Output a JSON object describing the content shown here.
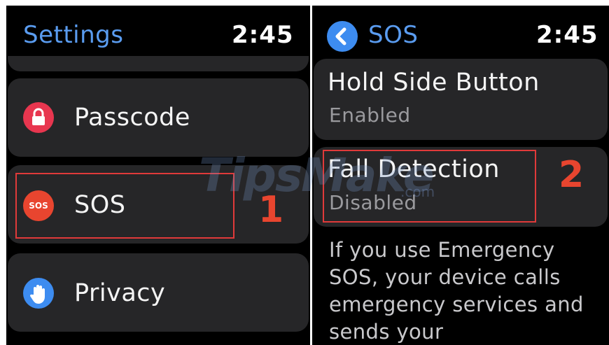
{
  "left_screen": {
    "title": "Settings",
    "time": "2:45",
    "rows": [
      {
        "label": "Passcode",
        "icon": "lock-icon",
        "icon_color": "#e8364f"
      },
      {
        "label": "SOS",
        "icon": "sos-icon",
        "icon_text": "SOS",
        "icon_color": "#e8452f"
      },
      {
        "label": "Privacy",
        "icon": "hand-icon",
        "icon_color": "#3d8cf0"
      }
    ],
    "step_number": "1"
  },
  "right_screen": {
    "back_icon": "chevron-left-icon",
    "title": "SOS",
    "time": "2:45",
    "hold_side_button": {
      "title": "Hold Side Button",
      "value": "Enabled"
    },
    "fall_detection": {
      "title": "Fall Detection",
      "value": "Disabled"
    },
    "description": "If you use Emergency SOS, your device calls emergency services and sends your",
    "step_number": "2"
  },
  "watermark": {
    "text": "TipsMake",
    "suffix": ".com"
  },
  "colors": {
    "accent_blue": "#5a9cf0",
    "cell_bg": "#262628",
    "highlight_red": "#e03a3a",
    "step_red": "#e8452f"
  }
}
